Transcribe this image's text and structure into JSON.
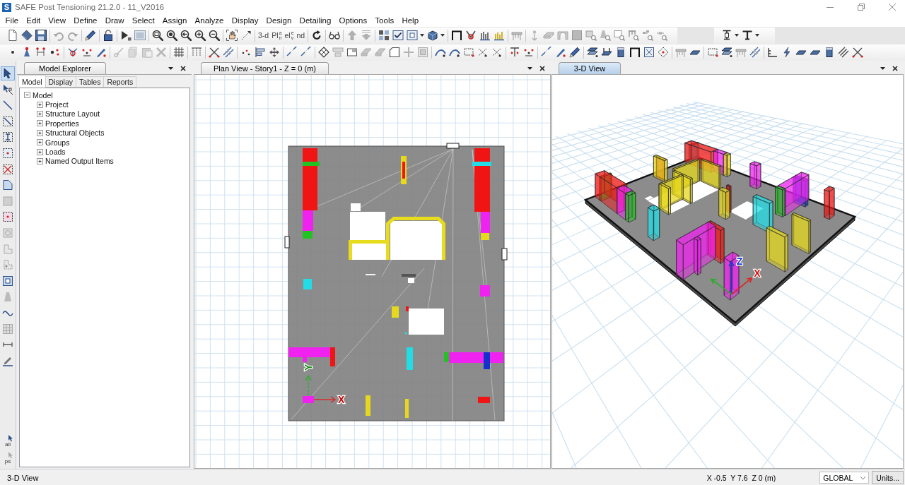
{
  "window": {
    "logo_letter": "S",
    "title": "SAFE Post Tensioning 21.2.0 - 11_V2016"
  },
  "menu": [
    "File",
    "Edit",
    "View",
    "Define",
    "Draw",
    "Select",
    "Assign",
    "Analyze",
    "Display",
    "Design",
    "Detailing",
    "Options",
    "Tools",
    "Help"
  ],
  "toolbar": {
    "view_buttons": [
      {
        "kind": "text",
        "label": "3-d"
      },
      {
        "kind": "stacked",
        "main": "Pl",
        "top": "a",
        "bottom": "n"
      },
      {
        "kind": "stacked",
        "main": "el",
        "top": "e",
        "bottom": "v"
      },
      {
        "kind": "text",
        "label": "nd"
      }
    ]
  },
  "left_toolbar": {
    "tools": [
      {
        "selected": true
      },
      {
        "selected": false
      },
      {
        "selected": false
      },
      {
        "selected": false
      },
      {
        "selected": false
      },
      {
        "selected": false
      },
      {
        "selected": false
      },
      {
        "selected": false
      },
      {
        "selected": false
      },
      {
        "selected": false
      },
      {
        "selected": false
      },
      {
        "selected": false
      },
      {
        "selected": false
      },
      {
        "selected": false
      },
      {
        "selected": false
      },
      {
        "selected": false
      },
      {
        "selected": false
      },
      {
        "selected": false
      },
      {
        "selected": false
      }
    ],
    "bottom_labels": [
      "all",
      "ps"
    ]
  },
  "model_explorer": {
    "title": "Model Explorer",
    "tabs": [
      {
        "label": "Model",
        "selected": true
      },
      {
        "label": "Display",
        "selected": false
      },
      {
        "label": "Tables",
        "selected": false
      },
      {
        "label": "Reports",
        "selected": false
      }
    ],
    "tree": {
      "label": "Model",
      "expanded": true,
      "children": [
        {
          "label": "Project",
          "expanded": false
        },
        {
          "label": "Structure Layout",
          "expanded": false
        },
        {
          "label": "Properties",
          "expanded": false
        },
        {
          "label": "Structural Objects",
          "expanded": false
        },
        {
          "label": "Groups",
          "expanded": false
        },
        {
          "label": "Loads",
          "expanded": false
        },
        {
          "label": "Named Output Items",
          "expanded": false
        }
      ]
    }
  },
  "views": [
    {
      "kind": "plan",
      "title": "Plan View - Story1 - Z = 0 (m)",
      "selected": false,
      "axis_labels": [
        "Y",
        "X"
      ]
    },
    {
      "kind": "perspective",
      "title": "3-D View",
      "selected": true,
      "axis_labels": [
        "Z",
        "X"
      ]
    }
  ],
  "status_bar": {
    "message": "3-D View",
    "coordinates": "X -0.5  Y 7.6  Z 0 (m)",
    "coordinate_system": "GLOBAL",
    "units_button": "Units..."
  }
}
